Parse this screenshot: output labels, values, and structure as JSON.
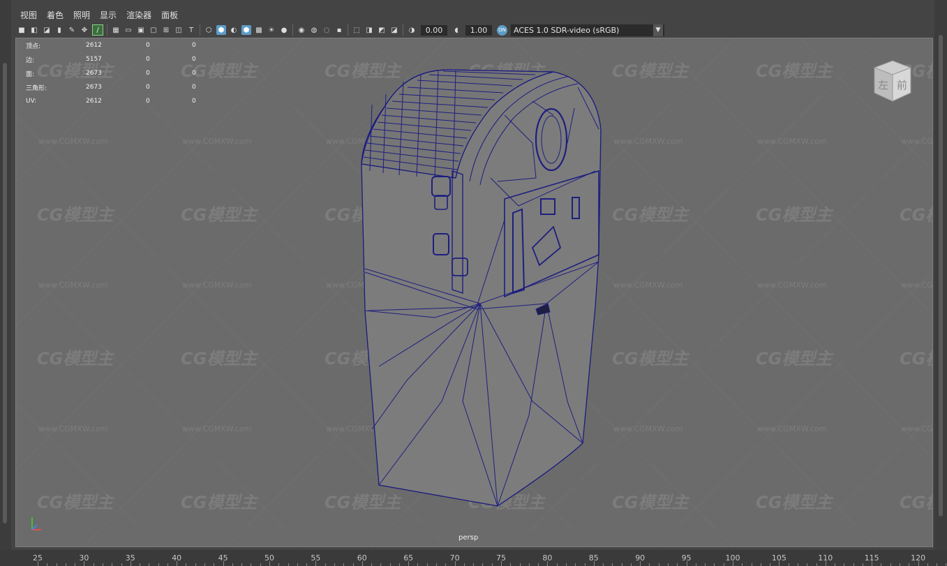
{
  "menubar": {
    "items": [
      "视图",
      "着色",
      "照明",
      "显示",
      "渲染器",
      "面板"
    ]
  },
  "toolbar": {
    "exposure_value": "0.00",
    "gamma_value": "1.00",
    "color_management_icon": "ON",
    "view_transform": "ACES 1.0 SDR-video (sRGB)"
  },
  "hud": {
    "rows": [
      {
        "label": "顶点:",
        "c1": "2612",
        "c2": "0",
        "c3": "0"
      },
      {
        "label": "边:",
        "c1": "5157",
        "c2": "0",
        "c3": "0"
      },
      {
        "label": "面:",
        "c1": "2673",
        "c2": "0",
        "c3": "0"
      },
      {
        "label": "三角形:",
        "c1": "2673",
        "c2": "0",
        "c3": "0"
      },
      {
        "label": "UV:",
        "c1": "2612",
        "c2": "0",
        "c3": "0"
      }
    ]
  },
  "viewcube": {
    "face_left": "左",
    "face_front": "前"
  },
  "viewport": {
    "camera_label": "persp",
    "watermark_logo": "CG模型主",
    "watermark_url": "www.CGMXW.com"
  },
  "timeline": {
    "ticks": [
      "25",
      "30",
      "35",
      "40",
      "45",
      "50",
      "55",
      "60",
      "65",
      "70",
      "75",
      "80",
      "85",
      "90",
      "95",
      "100",
      "105",
      "110",
      "115",
      "120"
    ]
  },
  "colors": {
    "viewport_bg": "#6b6b6b",
    "wireframe": "#1a1a7a",
    "accent": "#5d9cc7"
  }
}
